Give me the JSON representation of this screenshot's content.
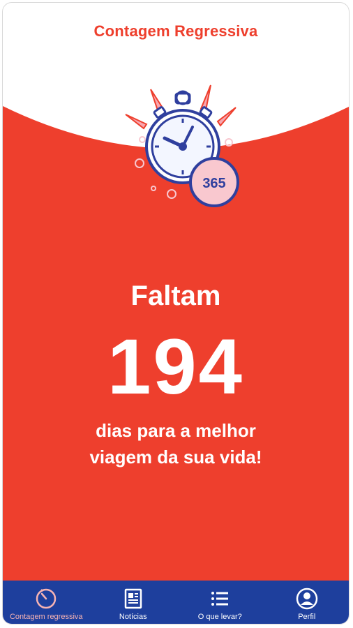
{
  "header": {
    "title": "Contagem Regressiva"
  },
  "illustration": {
    "badge_text": "365",
    "icon": "stopwatch-icon"
  },
  "countdown": {
    "prefix": "Faltam",
    "days": "194",
    "line1": "dias para a melhor",
    "line2": "viagem da sua vida!"
  },
  "navbar": {
    "items": [
      {
        "label": "Contagem regressiva",
        "icon": "timer-icon",
        "active": true
      },
      {
        "label": "Notícias",
        "icon": "newspaper-icon",
        "active": false
      },
      {
        "label": "O que levar?",
        "icon": "list-icon",
        "active": false
      },
      {
        "label": "Perfil",
        "icon": "profile-icon",
        "active": false
      }
    ]
  },
  "colors": {
    "accent_red": "#ee3f2d",
    "nav_blue": "#1e3f9d",
    "illustration_blue": "#2f3f9e",
    "badge_pink": "#f9c8cf"
  }
}
